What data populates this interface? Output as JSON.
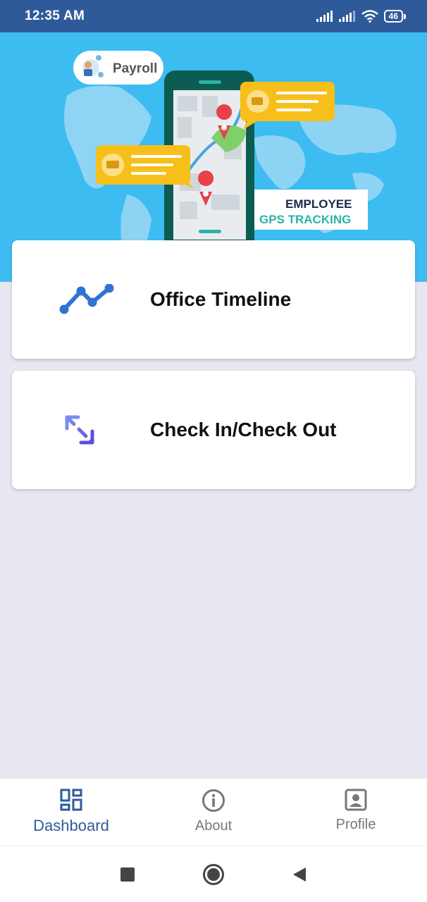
{
  "status_bar": {
    "time": "12:35 AM",
    "battery": "46",
    "icons": [
      "signal-icon",
      "signal-icon",
      "wifi-icon",
      "battery-icon"
    ]
  },
  "banner": {
    "payroll_label": "Payroll",
    "employee_label": "EMPLOYEE",
    "gps_label": "GPS TRACKING",
    "colors": {
      "background": "#3dbcf1",
      "phone": "#0c5c52",
      "bubble": "#f7bf1a",
      "accent": "#2bb3a8"
    }
  },
  "cards": [
    {
      "label": "Office Timeline",
      "icon": "timeline-icon"
    },
    {
      "label": "Check In/Check Out",
      "icon": "expand-arrows-icon"
    }
  ],
  "bottom_nav": {
    "items": [
      {
        "label": "Dashboard",
        "icon": "dashboard-icon",
        "active": true
      },
      {
        "label": "About",
        "icon": "info-icon",
        "active": false
      },
      {
        "label": "Profile",
        "icon": "profile-icon",
        "active": false
      }
    ],
    "active_color": "#2f5a9a"
  },
  "system_nav": {
    "buttons": [
      "recents-button",
      "home-button",
      "back-button"
    ]
  }
}
